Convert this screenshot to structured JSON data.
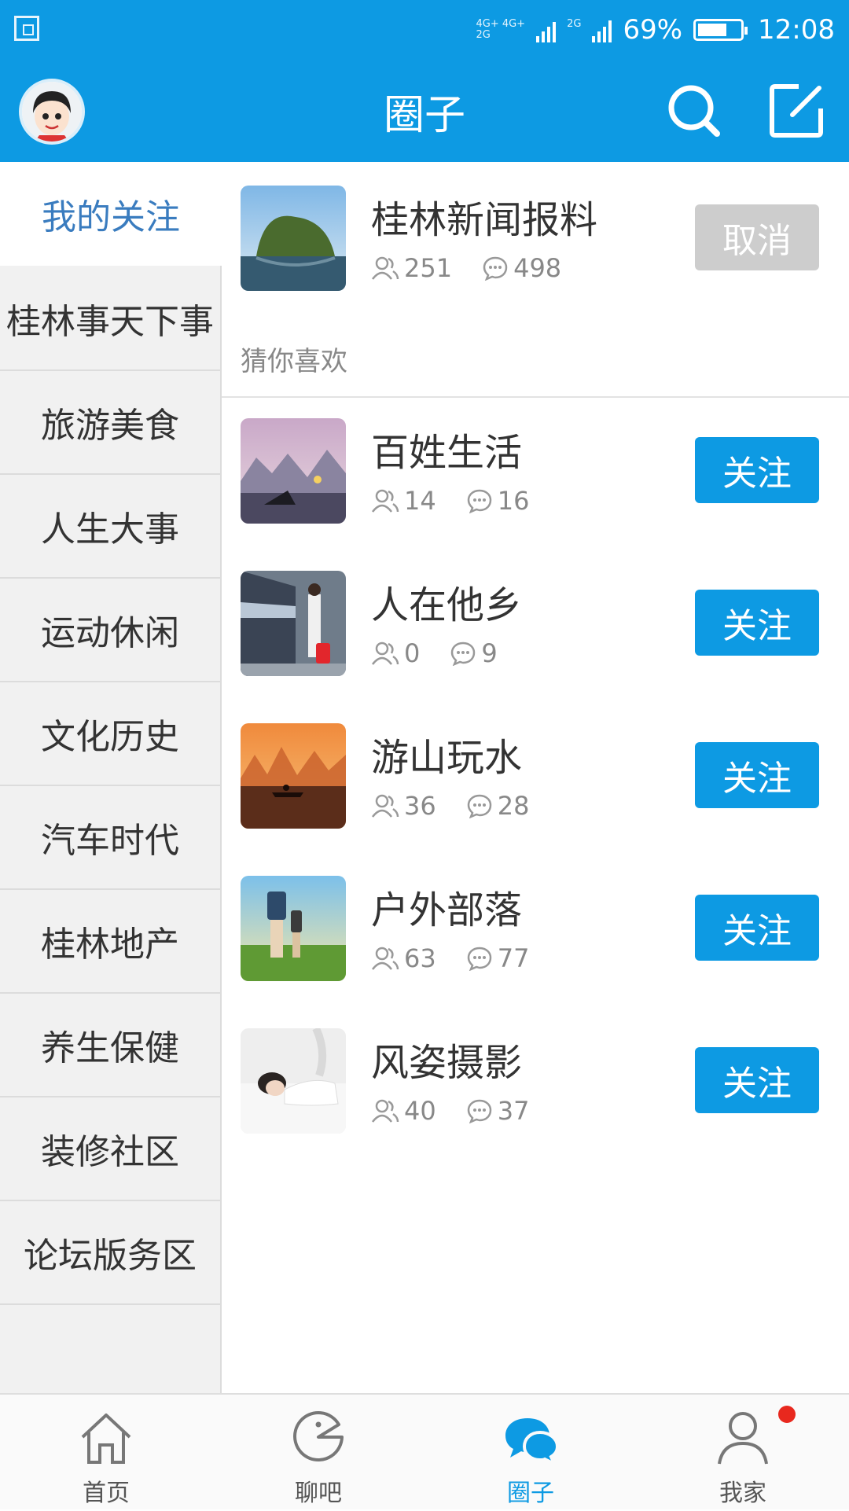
{
  "status_bar": {
    "network_top": "4G+ 4G+",
    "network_bottom": "2G",
    "network_2g": "2G",
    "battery_percent": "69%",
    "battery_level": 0.69,
    "time": "12:08"
  },
  "header": {
    "title": "圈子"
  },
  "sidebar": {
    "items": [
      {
        "label": "我的关注",
        "active": true
      },
      {
        "label": "桂林事天下事"
      },
      {
        "label": "旅游美食"
      },
      {
        "label": "人生大事"
      },
      {
        "label": "运动休闲"
      },
      {
        "label": "文化历史"
      },
      {
        "label": "汽车时代"
      },
      {
        "label": "桂林地产"
      },
      {
        "label": "养生保健"
      },
      {
        "label": "装修社区"
      },
      {
        "label": "论坛版务区"
      }
    ]
  },
  "followed": [
    {
      "title": "桂林新闻报料",
      "members": "251",
      "posts": "498",
      "button": "取消"
    }
  ],
  "section_label": "猜你喜欢",
  "recommended": [
    {
      "title": "百姓生活",
      "members": "14",
      "posts": "16",
      "button": "关注"
    },
    {
      "title": "人在他乡",
      "members": "0",
      "posts": "9",
      "button": "关注"
    },
    {
      "title": "游山玩水",
      "members": "36",
      "posts": "28",
      "button": "关注"
    },
    {
      "title": "户外部落",
      "members": "63",
      "posts": "77",
      "button": "关注"
    },
    {
      "title": "风姿摄影",
      "members": "40",
      "posts": "37",
      "button": "关注"
    }
  ],
  "bottom_nav": [
    {
      "label": "首页",
      "icon": "home-icon"
    },
    {
      "label": "聊吧",
      "icon": "chat-face-icon"
    },
    {
      "label": "圈子",
      "icon": "circle-bubbles-icon",
      "active": true
    },
    {
      "label": "我家",
      "icon": "person-icon",
      "badge": true
    }
  ],
  "colors": {
    "brand_blue": "#0d9ae3",
    "sidebar_active_text": "#3a7cbf",
    "cancel_gray": "#cdcdcd",
    "badge_red": "#e8281e"
  }
}
